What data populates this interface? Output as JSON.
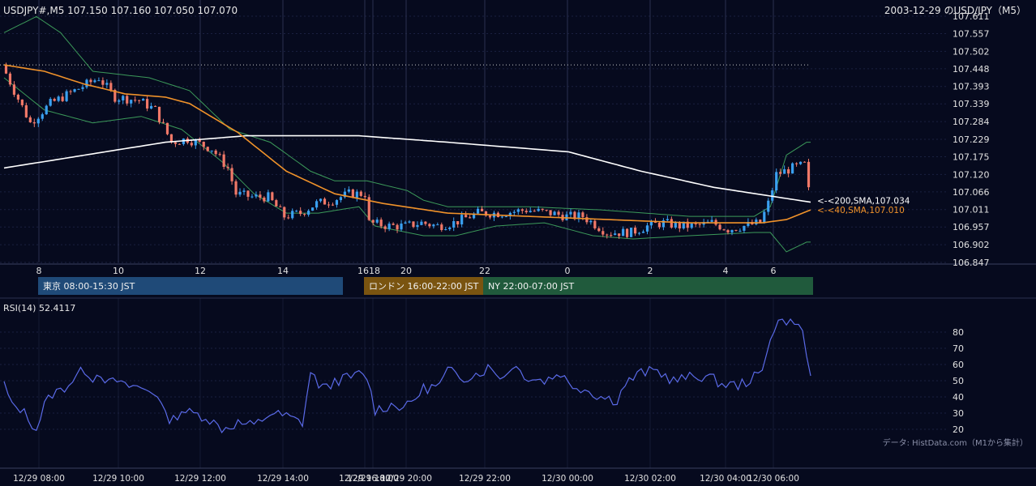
{
  "header": {
    "symbol_info": "USDJPY#,M5 107.150 107.160 107.050 107.070",
    "title_right": "2003-12-29 のUSD/JPY（M5）"
  },
  "colors": {
    "background": "#060a1e",
    "grid": "#1a2040",
    "bull": "#3aa0f0",
    "bear": "#f07868",
    "sma200": "#ffffff",
    "sma40": "#f0922a",
    "bollinger": "#3c9a5a",
    "rsi": "#5a6ae8",
    "session_tokyo": "#1f4a78",
    "session_london": "#7a5410",
    "session_ny": "#205a3c"
  },
  "sessions": [
    {
      "label": "東京 08:00-15:30 JST"
    },
    {
      "label": "ロンドン 16:00-22:00 JST"
    },
    {
      "label": "NY 22:00-07:00 JST"
    }
  ],
  "rsi_panel": {
    "label": "RSI(14) 52.4117",
    "ticks": [
      "80",
      "70",
      "60",
      "50",
      "40",
      "30",
      "20"
    ]
  },
  "attribution": "データ: HistData.com（M1から集計）",
  "chart_data": {
    "type": "candlestick",
    "price_axis": {
      "ticks": [
        "107.611",
        "107.557",
        "107.502",
        "107.448",
        "107.393",
        "107.339",
        "107.284",
        "107.229",
        "107.175",
        "107.120",
        "107.066",
        "107.011",
        "106.957",
        "106.902",
        "106.847"
      ],
      "ylim": [
        106.847,
        107.611
      ]
    },
    "hour_ticks": [
      "8",
      "10",
      "12",
      "14",
      "16",
      "18",
      "20",
      "22",
      "0",
      "2",
      "4",
      "6"
    ],
    "time_labels": [
      "12/29 08:00",
      "12/29 10:00",
      "12/29 12:00",
      "12/29 14:00",
      "12/29 16:00",
      "12/29 18:00",
      "12/29 20:00",
      "12/29 22:00",
      "12/30 00:00",
      "12/30 02:00",
      "12/30 04:00",
      "12/30 06:00"
    ],
    "annotations": [
      {
        "text": "<-<200,SMA,107.034",
        "value": 107.034,
        "color": "#ffffff"
      },
      {
        "text": "<-<40,SMA,107.010",
        "value": 107.01,
        "color": "#f0922a"
      }
    ],
    "reference_line": 107.46,
    "series_keypoints": {
      "close": [
        [
          0,
          107.46
        ],
        [
          3,
          107.38
        ],
        [
          7,
          107.28
        ],
        [
          12,
          107.34
        ],
        [
          18,
          107.38
        ],
        [
          24,
          107.42
        ],
        [
          28,
          107.36
        ],
        [
          34,
          107.35
        ],
        [
          38,
          107.32
        ],
        [
          42,
          107.22
        ],
        [
          46,
          107.23
        ],
        [
          52,
          107.2
        ],
        [
          56,
          107.14
        ],
        [
          58,
          107.06
        ],
        [
          62,
          107.05
        ],
        [
          66,
          107.05
        ],
        [
          70,
          106.99
        ],
        [
          74,
          107.0
        ],
        [
          78,
          107.03
        ],
        [
          82,
          107.04
        ],
        [
          86,
          107.06
        ],
        [
          90,
          107.06
        ],
        [
          91,
          106.97
        ],
        [
          96,
          106.96
        ],
        [
          100,
          106.96
        ],
        [
          104,
          106.97
        ],
        [
          108,
          106.96
        ],
        [
          112,
          106.97
        ],
        [
          118,
          107.0
        ],
        [
          124,
          107.0
        ],
        [
          130,
          107.01
        ],
        [
          136,
          107.0
        ],
        [
          140,
          106.99
        ],
        [
          144,
          106.99
        ],
        [
          150,
          106.94
        ],
        [
          156,
          106.94
        ],
        [
          160,
          106.96
        ],
        [
          164,
          106.97
        ],
        [
          168,
          106.96
        ],
        [
          172,
          106.96
        ],
        [
          176,
          106.97
        ],
        [
          180,
          106.95
        ],
        [
          184,
          106.96
        ],
        [
          188,
          106.97
        ],
        [
          190,
          107.03
        ],
        [
          192,
          107.12
        ],
        [
          196,
          107.14
        ],
        [
          199,
          107.15
        ],
        [
          200,
          107.07
        ]
      ],
      "sma200": [
        [
          0,
          107.14
        ],
        [
          20,
          107.18
        ],
        [
          40,
          107.22
        ],
        [
          60,
          107.24
        ],
        [
          88,
          107.24
        ],
        [
          110,
          107.22
        ],
        [
          140,
          107.19
        ],
        [
          158,
          107.13
        ],
        [
          176,
          107.08
        ],
        [
          200,
          107.034
        ]
      ],
      "sma40": [
        [
          0,
          107.46
        ],
        [
          10,
          107.44
        ],
        [
          20,
          107.4
        ],
        [
          30,
          107.37
        ],
        [
          40,
          107.36
        ],
        [
          46,
          107.34
        ],
        [
          58,
          107.25
        ],
        [
          70,
          107.13
        ],
        [
          82,
          107.06
        ],
        [
          94,
          107.03
        ],
        [
          110,
          107.0
        ],
        [
          130,
          106.99
        ],
        [
          150,
          106.98
        ],
        [
          170,
          106.97
        ],
        [
          188,
          106.97
        ],
        [
          194,
          106.98
        ],
        [
          200,
          107.01
        ]
      ],
      "boll_upper": [
        [
          0,
          107.56
        ],
        [
          8,
          107.61
        ],
        [
          14,
          107.56
        ],
        [
          22,
          107.44
        ],
        [
          36,
          107.42
        ],
        [
          46,
          107.38
        ],
        [
          56,
          107.26
        ],
        [
          66,
          107.22
        ],
        [
          76,
          107.13
        ],
        [
          82,
          107.1
        ],
        [
          90,
          107.1
        ],
        [
          100,
          107.07
        ],
        [
          104,
          107.04
        ],
        [
          110,
          107.02
        ],
        [
          130,
          107.02
        ],
        [
          148,
          107.01
        ],
        [
          170,
          106.99
        ],
        [
          186,
          106.99
        ],
        [
          190,
          107.02
        ],
        [
          194,
          107.18
        ],
        [
          199,
          107.22
        ]
      ],
      "boll_lower": [
        [
          0,
          107.42
        ],
        [
          10,
          107.32
        ],
        [
          22,
          107.28
        ],
        [
          34,
          107.3
        ],
        [
          44,
          107.26
        ],
        [
          54,
          107.16
        ],
        [
          62,
          107.06
        ],
        [
          70,
          107.0
        ],
        [
          78,
          107.0
        ],
        [
          88,
          107.02
        ],
        [
          92,
          106.96
        ],
        [
          104,
          106.93
        ],
        [
          112,
          106.93
        ],
        [
          122,
          106.96
        ],
        [
          134,
          106.97
        ],
        [
          146,
          106.93
        ],
        [
          156,
          106.92
        ],
        [
          170,
          106.93
        ],
        [
          186,
          106.94
        ],
        [
          190,
          106.94
        ],
        [
          194,
          106.88
        ],
        [
          199,
          106.91
        ]
      ],
      "rsi": [
        [
          0,
          48
        ],
        [
          2,
          34
        ],
        [
          4,
          33
        ],
        [
          6,
          27
        ],
        [
          8,
          20
        ],
        [
          10,
          35
        ],
        [
          12,
          42
        ],
        [
          14,
          44
        ],
        [
          16,
          48
        ],
        [
          18,
          53
        ],
        [
          20,
          57
        ],
        [
          22,
          52
        ],
        [
          24,
          55
        ],
        [
          26,
          48
        ],
        [
          28,
          50
        ],
        [
          30,
          46
        ],
        [
          32,
          47
        ],
        [
          34,
          45
        ],
        [
          36,
          44
        ],
        [
          38,
          42
        ],
        [
          40,
          28
        ],
        [
          42,
          26
        ],
        [
          44,
          32
        ],
        [
          46,
          30
        ],
        [
          50,
          28
        ],
        [
          54,
          20
        ],
        [
          58,
          24
        ],
        [
          62,
          22
        ],
        [
          66,
          30
        ],
        [
          70,
          28
        ],
        [
          74,
          24
        ],
        [
          76,
          55
        ],
        [
          78,
          48
        ],
        [
          80,
          45
        ],
        [
          82,
          50
        ],
        [
          86,
          52
        ],
        [
          88,
          54
        ],
        [
          90,
          52
        ],
        [
          92,
          32
        ],
        [
          96,
          35
        ],
        [
          100,
          34
        ],
        [
          104,
          45
        ],
        [
          108,
          47
        ],
        [
          110,
          56
        ],
        [
          114,
          52
        ],
        [
          118,
          55
        ],
        [
          120,
          58
        ],
        [
          124,
          52
        ],
        [
          126,
          60
        ],
        [
          130,
          52
        ],
        [
          134,
          50
        ],
        [
          138,
          55
        ],
        [
          140,
          48
        ],
        [
          144,
          45
        ],
        [
          148,
          40
        ],
        [
          152,
          38
        ],
        [
          154,
          48
        ],
        [
          158,
          55
        ],
        [
          162,
          56
        ],
        [
          166,
          50
        ],
        [
          170,
          52
        ],
        [
          174,
          53
        ],
        [
          178,
          48
        ],
        [
          182,
          47
        ],
        [
          186,
          52
        ],
        [
          188,
          55
        ],
        [
          190,
          78
        ],
        [
          192,
          87
        ],
        [
          196,
          88
        ],
        [
          198,
          79
        ],
        [
          200,
          53
        ]
      ]
    }
  }
}
